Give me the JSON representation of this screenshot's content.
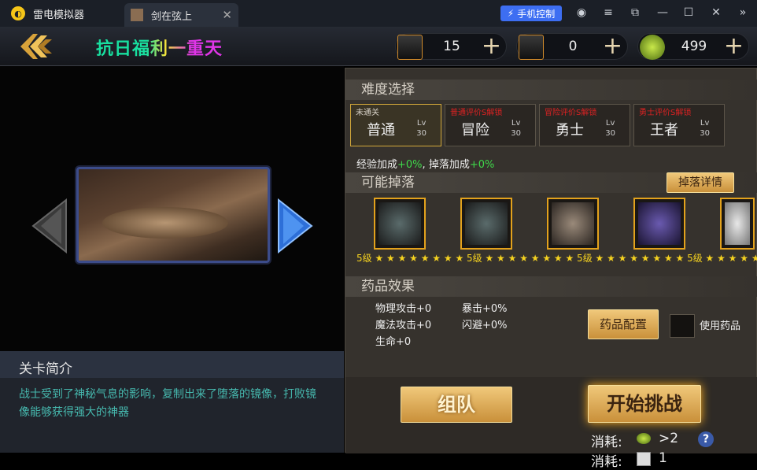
{
  "window": {
    "app_name": "雷电模拟器",
    "tab_title": "剑在弦上",
    "phone_control": "手机控制"
  },
  "header": {
    "stage_name": "抗日福利一重天"
  },
  "resources": [
    {
      "value": "15"
    },
    {
      "value": "0"
    },
    {
      "value": "499"
    }
  ],
  "intro": {
    "title": "关卡简介",
    "text": "战士受到了神秘气息的影响，复制出来了堕落的镜像，打败镜像能够获得强大的神器"
  },
  "difficulty": {
    "title": "难度选择",
    "options": [
      {
        "tag": "未通关",
        "name": "普通",
        "lv": "Lv",
        "lv_num": "30",
        "selected": true
      },
      {
        "tag": "普通评价S解锁",
        "name": "冒险",
        "lv": "Lv",
        "lv_num": "30"
      },
      {
        "tag": "冒险评价S解锁",
        "name": "勇士",
        "lv": "Lv",
        "lv_num": "30"
      },
      {
        "tag": "勇士评价S解锁",
        "name": "王者",
        "lv": "Lv",
        "lv_num": "30"
      }
    ]
  },
  "bonus": {
    "exp_label": "经验加成",
    "exp_value": "+0%",
    "sep": ", ",
    "drop_label": "掉落加成",
    "drop_value": "+0%"
  },
  "drops": {
    "title": "可能掉落",
    "detail_button": "掉落详情",
    "stars_text": "5级 ★ ★ ★ ★ ★ ★ ★ ★ 5级 ★ ★ ★ ★ ★ ★ ★ ★ 5级 ★ ★ ★ ★ ★ ★ ★ ★ 5级 ★ ★ ★ ★ ★ ★ ★ ★ 5级 ★ ★ ★"
  },
  "potion": {
    "title": "药品效果",
    "physical_attack": "物理攻击+0",
    "magic_attack": "魔法攻击+0",
    "hp": "生命+0",
    "crit": "暴击+0%",
    "dodge": "闪避+0%",
    "config_button": "药品配置",
    "use_label": "使用药品"
  },
  "actions": {
    "team_button": "组队",
    "start_button": "开始挑战",
    "cost_label_1": "消耗:",
    "cost_value_1": ">2",
    "cost_label_2": "消耗:",
    "cost_value_2": "1",
    "help": "?"
  },
  "colors": {
    "accent_gold": "#d2a83a",
    "title_green": "#18e0a0",
    "title_yellow": "#f5e23a",
    "title_magenta": "#e035e8",
    "bonus_green": "#3fd84a"
  }
}
